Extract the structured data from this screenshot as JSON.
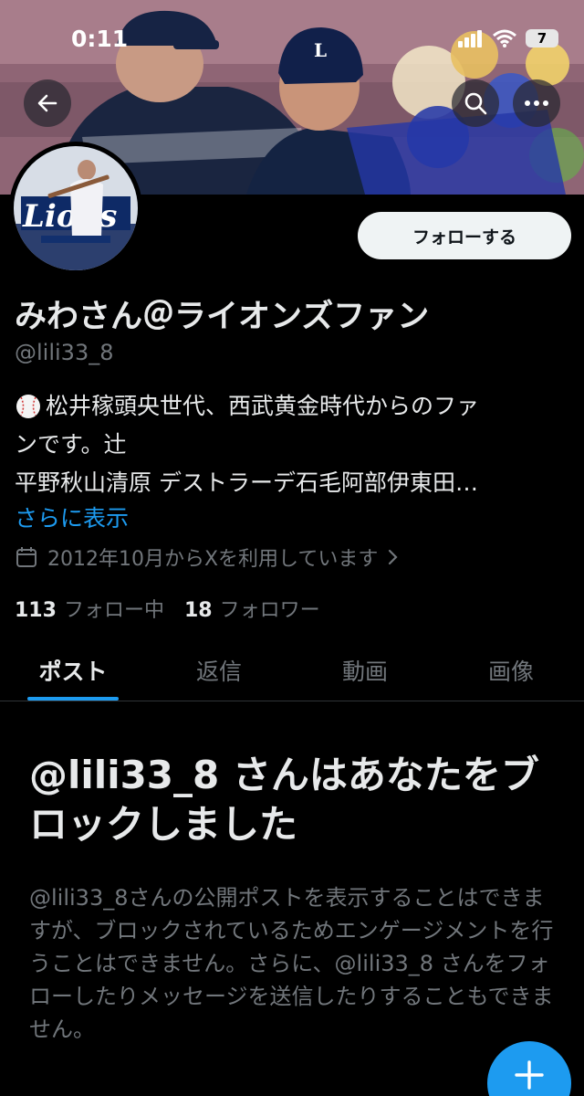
{
  "status_bar": {
    "time": "0:11",
    "battery": "7"
  },
  "header": {
    "back_icon": "arrow-left-icon",
    "search_icon": "search-icon",
    "more_icon": "more-horizontal-icon"
  },
  "profile": {
    "follow_label": "フォローする",
    "display_name": "みわさん＠ライオンズファン",
    "handle": "@lili33_8",
    "bio_lines": [
      "松井稼頭央世代、西武黄金時代からのファ",
      "ンです。辻",
      "平野秋山清原 デストラーデ石毛阿部伊東田…"
    ],
    "show_more": "さらに表示",
    "joined": "2012年10月からXを利用しています",
    "following_count": "113",
    "following_label": "フォロー中",
    "followers_count": "18",
    "followers_label": "フォロワー"
  },
  "tabs": [
    {
      "label": "ポスト",
      "active": true
    },
    {
      "label": "返信",
      "active": false
    },
    {
      "label": "動画",
      "active": false
    },
    {
      "label": "画像",
      "active": false
    }
  ],
  "blocked": {
    "title": "@lili33_8 さんはあなたをブロックしました",
    "text": "@lili33_8さんの公開ポストを表示することはできますが、ブロックされているためエンゲージメントを行うことはできません。さらに、@lili33_8 さんをフォローしたりメッセージを送信したりすることもできません。"
  },
  "colors": {
    "accent": "#1d9bf0",
    "background": "#000000",
    "secondary_text": "#71767b"
  }
}
